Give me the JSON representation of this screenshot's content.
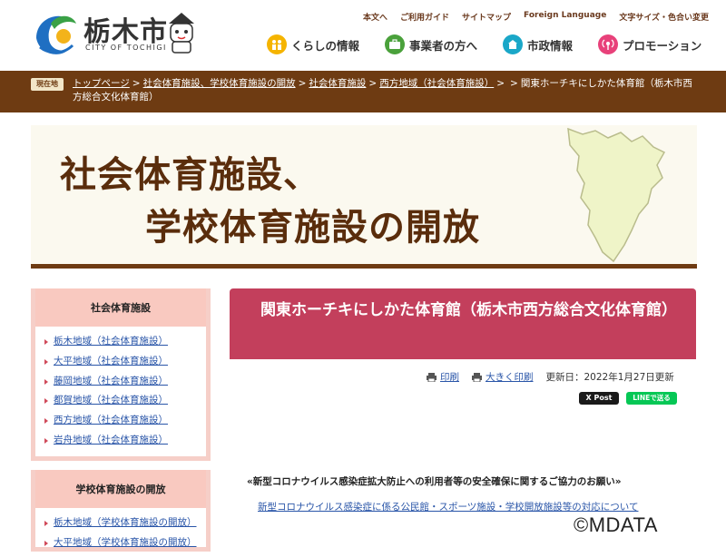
{
  "header": {
    "logo_name": "栃木市",
    "logo_sub": "CITY OF TOCHIGI",
    "util_nav": [
      "本文へ",
      "ご利用ガイド",
      "サイトマップ",
      "Foreign Language",
      "文字サイズ・色合い変更"
    ],
    "main_nav": [
      {
        "label": "くらしの情報",
        "icon": "family-icon",
        "color": "#f5b400"
      },
      {
        "label": "事業者の方へ",
        "icon": "briefcase-icon",
        "color": "#4aa13b"
      },
      {
        "label": "市政情報",
        "icon": "city-hall-icon",
        "color": "#1aa7c8"
      },
      {
        "label": "プロモーション",
        "icon": "broadcast-icon",
        "color": "#e8417a"
      }
    ]
  },
  "breadcrumb": {
    "here_label": "現在地",
    "items": [
      "トップページ",
      "社会体育施設、学校体育施設の開放",
      "社会体育施設",
      "西方地域（社会体育施設）"
    ],
    "current": "関東ホーチキにしかた体育館（栃木市西方総合文化体育館）"
  },
  "banner": {
    "line1": "社会体育施設、",
    "line2": "学校体育施設の開放"
  },
  "sidebar": {
    "sections": [
      {
        "title": "社会体育施設",
        "items": [
          "栃木地域（社会体育施設）",
          "大平地域（社会体育施設）",
          "藤岡地域（社会体育施設）",
          "都賀地域（社会体育施設）",
          "西方地域（社会体育施設）",
          "岩舟地域（社会体育施設）"
        ]
      },
      {
        "title": "学校体育施設の開放",
        "items": [
          "栃木地域（学校体育施設の開放）",
          "大平地域（学校体育施設の開放）"
        ]
      }
    ]
  },
  "content": {
    "title": "関東ホーチキにしかた体育館（栃木市西方総合文化体育館）",
    "print_label": "印刷",
    "large_print_label": "大きく印刷",
    "updated": "更新日：2022年1月27日更新",
    "xpost_label": "X Post",
    "line_label": "LINEで送る",
    "notice": "«新型コロナウイルス感染症拡大防止への利用者等の安全確保に関するご協力のお願い»",
    "notice_link": "新型コロナウイルス感染症に係る公民館・スポーツ施設・学校開放施設等の対応について"
  },
  "watermark": "©MDATA",
  "colors": {
    "brown": "#6e3b12",
    "title_pink": "#c33f5c",
    "sidebar_head": "#f9c9c0",
    "link": "#2955a8"
  }
}
